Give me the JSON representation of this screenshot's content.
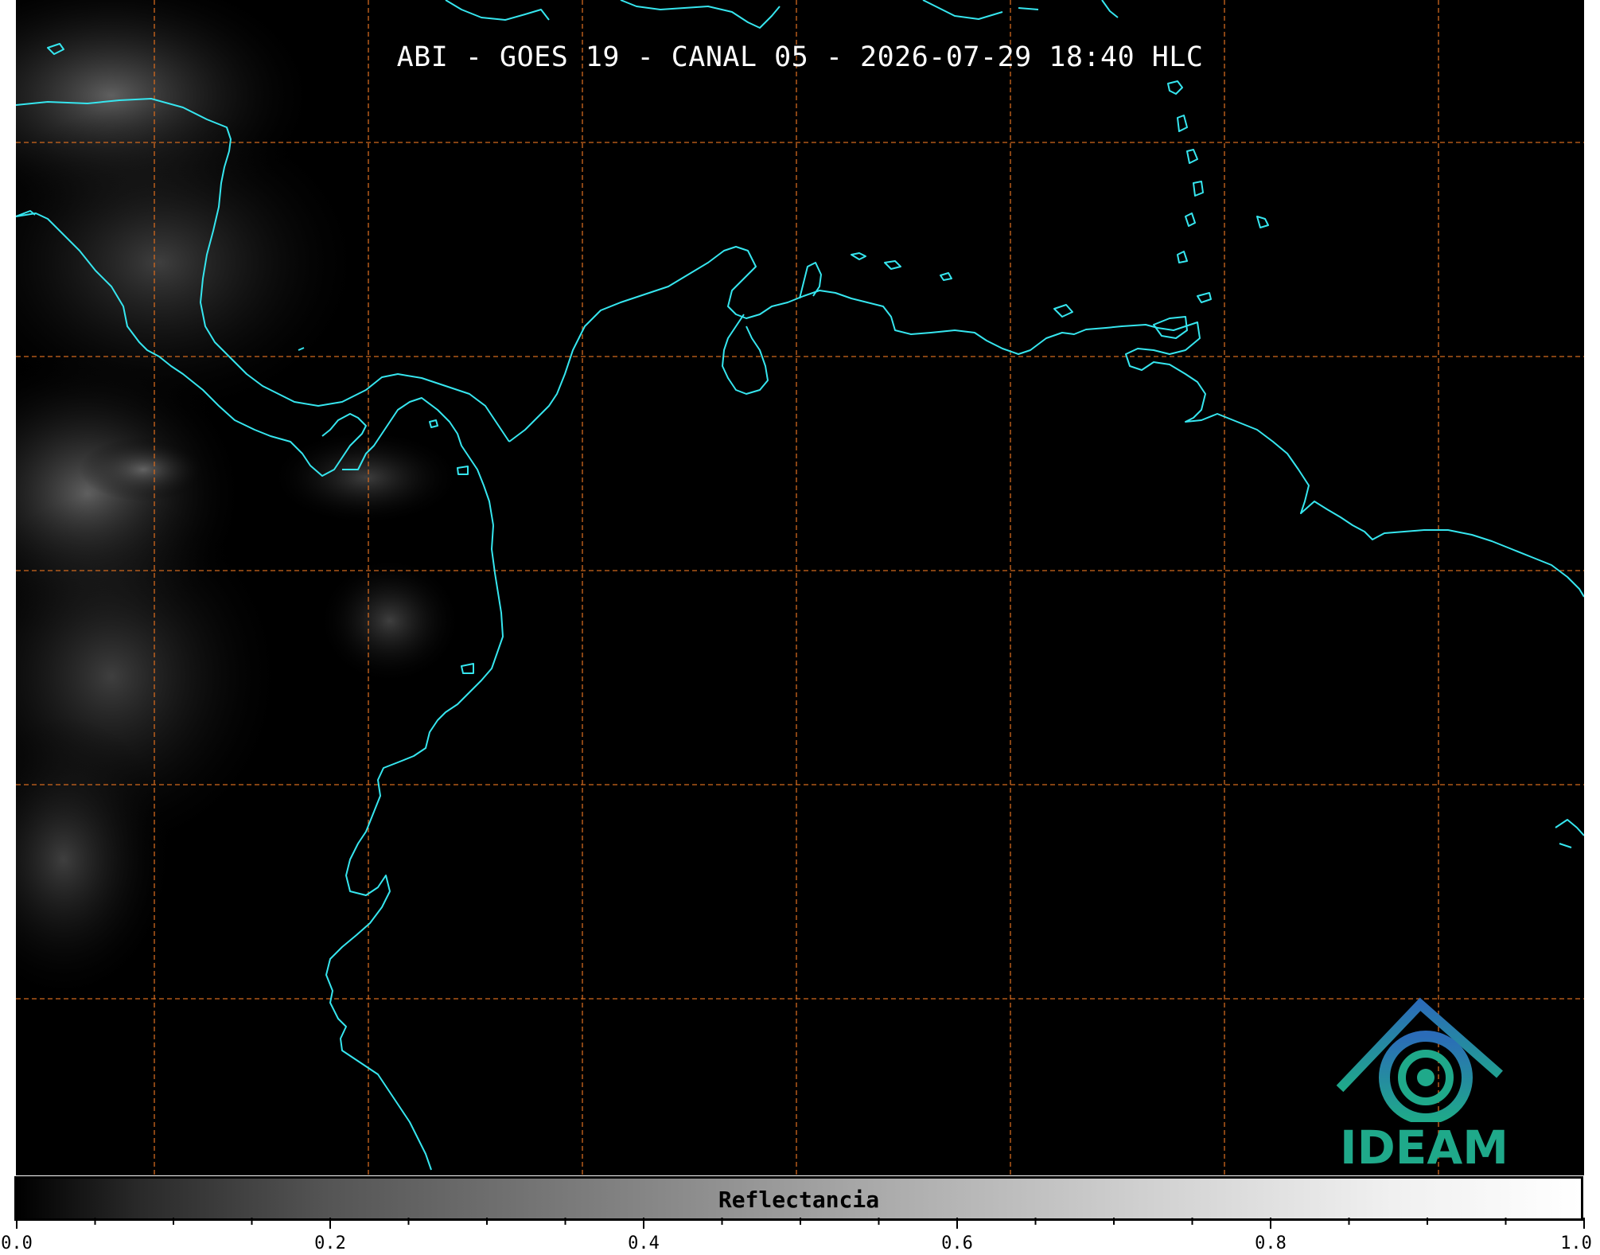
{
  "map": {
    "title": "ABI - GOES 19 - CANAL 05 - 2026-07-29 18:40 HLC",
    "coastline_color": "#36e6ef",
    "gridline_color": "#d2691e",
    "background_color": "#000000"
  },
  "logo": {
    "text": "IDEAM",
    "icon": "ideam-logo-icon",
    "color": "#1fa98a"
  },
  "colorbar": {
    "label": "Reflectancia",
    "min": 0.0,
    "max": 1.0,
    "tick_labels": [
      "0.0",
      "0.2",
      "0.4",
      "0.6",
      "0.8",
      "1.0"
    ]
  }
}
